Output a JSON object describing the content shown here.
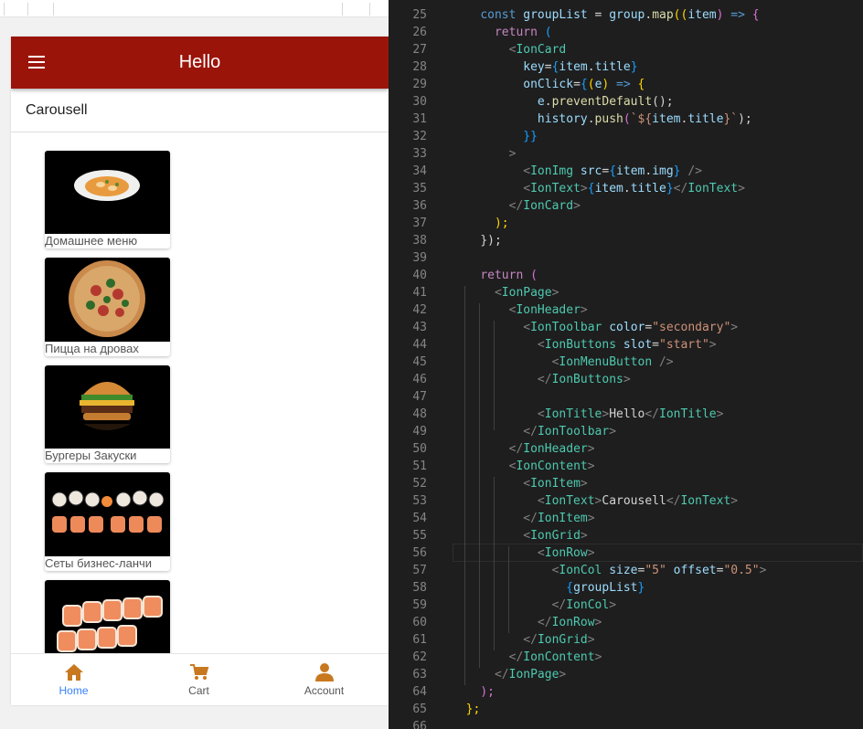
{
  "app": {
    "toolbar_title": "Hello",
    "content_item": "Carousell",
    "accent_color": "#9b1409",
    "tab_active_color": "#3880ff",
    "tab_icon_color": "#c8791f"
  },
  "cards": [
    {
      "title": "Домашнее меню",
      "image": "soup-bowl"
    },
    {
      "title": "Пицца на дровах",
      "image": "pizza"
    },
    {
      "title": "Бургеры Закуски",
      "image": "burger"
    },
    {
      "title": "Сеты бизнес-ланчи",
      "image": "sushi-set"
    },
    {
      "title": "",
      "image": "sushi-rolls"
    }
  ],
  "tabs": [
    {
      "label": "Home",
      "icon": "home-icon",
      "active": true
    },
    {
      "label": "Cart",
      "icon": "cart-icon",
      "active": false
    },
    {
      "label": "Account",
      "icon": "person-icon",
      "active": false
    }
  ],
  "editor": {
    "lines": [
      {
        "n": "25",
        "tokens": [
          [
            "    ",
            ""
          ],
          [
            "const",
            "kw"
          ],
          [
            " ",
            "txt"
          ],
          [
            "groupList",
            "var"
          ],
          [
            " = ",
            "pun"
          ],
          [
            "group",
            "var"
          ],
          [
            ".",
            "pun"
          ],
          [
            "map",
            "fn"
          ],
          [
            "((",
            "yel"
          ],
          [
            "item",
            "var"
          ],
          [
            ")",
            "pur"
          ],
          [
            " ",
            "txt"
          ],
          [
            "=>",
            "kw"
          ],
          [
            " ",
            "txt"
          ],
          [
            "{",
            "pur"
          ]
        ]
      },
      {
        "n": "26",
        "tokens": [
          [
            "      ",
            ""
          ],
          [
            "return",
            "ctl"
          ],
          [
            " ",
            "txt"
          ],
          [
            "(",
            "blu"
          ]
        ]
      },
      {
        "n": "27",
        "tokens": [
          [
            "        ",
            ""
          ],
          [
            "<",
            "br"
          ],
          [
            "IonCard",
            "tag"
          ]
        ]
      },
      {
        "n": "28",
        "tokens": [
          [
            "          ",
            ""
          ],
          [
            "key",
            "attr"
          ],
          [
            "=",
            "pun"
          ],
          [
            "{",
            "blu"
          ],
          [
            "item",
            "var"
          ],
          [
            ".",
            "pun"
          ],
          [
            "title",
            "var"
          ],
          [
            "}",
            "blu"
          ]
        ]
      },
      {
        "n": "29",
        "tokens": [
          [
            "          ",
            ""
          ],
          [
            "onClick",
            "attr"
          ],
          [
            "=",
            "pun"
          ],
          [
            "{",
            "blu"
          ],
          [
            "(",
            "yel"
          ],
          [
            "e",
            "var"
          ],
          [
            ")",
            "yel"
          ],
          [
            " ",
            "txt"
          ],
          [
            "=>",
            "kw"
          ],
          [
            " ",
            "txt"
          ],
          [
            "{",
            "yel"
          ]
        ]
      },
      {
        "n": "30",
        "tokens": [
          [
            "            ",
            ""
          ],
          [
            "e",
            "var"
          ],
          [
            ".",
            "pun"
          ],
          [
            "preventDefault",
            "fn"
          ],
          [
            "();",
            "pun"
          ]
        ]
      },
      {
        "n": "31",
        "tokens": [
          [
            "            ",
            ""
          ],
          [
            "history",
            "var"
          ],
          [
            ".",
            "pun"
          ],
          [
            "push",
            "fn"
          ],
          [
            "(",
            "pur"
          ],
          [
            "`${",
            "str"
          ],
          [
            "item",
            "var"
          ],
          [
            ".",
            "pun"
          ],
          [
            "title",
            "var"
          ],
          [
            "}`",
            "str"
          ],
          [
            ");",
            "pun"
          ]
        ]
      },
      {
        "n": "32",
        "tokens": [
          [
            "          ",
            ""
          ],
          [
            "}}",
            "blu"
          ]
        ]
      },
      {
        "n": "33",
        "tokens": [
          [
            "        ",
            ""
          ],
          [
            ">",
            "br"
          ]
        ]
      },
      {
        "n": "34",
        "tokens": [
          [
            "          ",
            ""
          ],
          [
            "<",
            "br"
          ],
          [
            "IonImg",
            "tag"
          ],
          [
            " ",
            "txt"
          ],
          [
            "src",
            "attr"
          ],
          [
            "=",
            "pun"
          ],
          [
            "{",
            "blu"
          ],
          [
            "item",
            "var"
          ],
          [
            ".",
            "pun"
          ],
          [
            "img",
            "var"
          ],
          [
            "}",
            "blu"
          ],
          [
            " ",
            "txt"
          ],
          [
            "/>",
            "br"
          ]
        ]
      },
      {
        "n": "35",
        "tokens": [
          [
            "          ",
            ""
          ],
          [
            "<",
            "br"
          ],
          [
            "IonText",
            "tag"
          ],
          [
            ">",
            "br"
          ],
          [
            "{",
            "blu"
          ],
          [
            "item",
            "var"
          ],
          [
            ".",
            "pun"
          ],
          [
            "title",
            "var"
          ],
          [
            "}",
            "blu"
          ],
          [
            "</",
            "br"
          ],
          [
            "IonText",
            "tag"
          ],
          [
            ">",
            "br"
          ]
        ]
      },
      {
        "n": "36",
        "tokens": [
          [
            "        ",
            ""
          ],
          [
            "</",
            "br"
          ],
          [
            "IonCard",
            "tag"
          ],
          [
            ">",
            "br"
          ]
        ]
      },
      {
        "n": "37",
        "tokens": [
          [
            "      ",
            ""
          ],
          [
            ");",
            "yel"
          ]
        ]
      },
      {
        "n": "38",
        "tokens": [
          [
            "    ",
            ""
          ],
          [
            "});",
            "pun"
          ]
        ]
      },
      {
        "n": "39",
        "tokens": []
      },
      {
        "n": "40",
        "tokens": [
          [
            "    ",
            ""
          ],
          [
            "return",
            "ctl"
          ],
          [
            " ",
            "txt"
          ],
          [
            "(",
            "pur"
          ]
        ]
      },
      {
        "n": "41",
        "tokens": [
          [
            "      ",
            ""
          ],
          [
            "<",
            "br"
          ],
          [
            "IonPage",
            "tag"
          ],
          [
            ">",
            "br"
          ]
        ]
      },
      {
        "n": "42",
        "tokens": [
          [
            "        ",
            ""
          ],
          [
            "<",
            "br"
          ],
          [
            "IonHeader",
            "tag"
          ],
          [
            ">",
            "br"
          ]
        ]
      },
      {
        "n": "43",
        "tokens": [
          [
            "          ",
            ""
          ],
          [
            "<",
            "br"
          ],
          [
            "IonToolbar",
            "tag"
          ],
          [
            " ",
            "txt"
          ],
          [
            "color",
            "attr"
          ],
          [
            "=",
            "pun"
          ],
          [
            "\"secondary\"",
            "str"
          ],
          [
            ">",
            "br"
          ]
        ]
      },
      {
        "n": "44",
        "tokens": [
          [
            "            ",
            ""
          ],
          [
            "<",
            "br"
          ],
          [
            "IonButtons",
            "tag"
          ],
          [
            " ",
            "txt"
          ],
          [
            "slot",
            "attr"
          ],
          [
            "=",
            "pun"
          ],
          [
            "\"start\"",
            "str"
          ],
          [
            ">",
            "br"
          ]
        ]
      },
      {
        "n": "45",
        "tokens": [
          [
            "              ",
            ""
          ],
          [
            "<",
            "br"
          ],
          [
            "IonMenuButton",
            "tag"
          ],
          [
            " ",
            "txt"
          ],
          [
            "/>",
            "br"
          ]
        ]
      },
      {
        "n": "46",
        "tokens": [
          [
            "            ",
            ""
          ],
          [
            "</",
            "br"
          ],
          [
            "IonButtons",
            "tag"
          ],
          [
            ">",
            "br"
          ]
        ]
      },
      {
        "n": "47",
        "tokens": []
      },
      {
        "n": "48",
        "tokens": [
          [
            "            ",
            ""
          ],
          [
            "<",
            "br"
          ],
          [
            "IonTitle",
            "tag"
          ],
          [
            ">",
            "br"
          ],
          [
            "Hello",
            "txt"
          ],
          [
            "</",
            "br"
          ],
          [
            "IonTitle",
            "tag"
          ],
          [
            ">",
            "br"
          ]
        ]
      },
      {
        "n": "49",
        "tokens": [
          [
            "          ",
            ""
          ],
          [
            "</",
            "br"
          ],
          [
            "IonToolbar",
            "tag"
          ],
          [
            ">",
            "br"
          ]
        ]
      },
      {
        "n": "50",
        "tokens": [
          [
            "        ",
            ""
          ],
          [
            "</",
            "br"
          ],
          [
            "IonHeader",
            "tag"
          ],
          [
            ">",
            "br"
          ]
        ]
      },
      {
        "n": "51",
        "tokens": [
          [
            "        ",
            ""
          ],
          [
            "<",
            "br"
          ],
          [
            "IonContent",
            "tag"
          ],
          [
            ">",
            "br"
          ]
        ]
      },
      {
        "n": "52",
        "tokens": [
          [
            "          ",
            ""
          ],
          [
            "<",
            "br"
          ],
          [
            "IonItem",
            "tag"
          ],
          [
            ">",
            "br"
          ]
        ]
      },
      {
        "n": "53",
        "tokens": [
          [
            "            ",
            ""
          ],
          [
            "<",
            "br"
          ],
          [
            "IonText",
            "tag"
          ],
          [
            ">",
            "br"
          ],
          [
            "Carousell",
            "txt"
          ],
          [
            "</",
            "br"
          ],
          [
            "IonText",
            "tag"
          ],
          [
            ">",
            "br"
          ]
        ]
      },
      {
        "n": "54",
        "tokens": [
          [
            "          ",
            ""
          ],
          [
            "</",
            "br"
          ],
          [
            "IonItem",
            "tag"
          ],
          [
            ">",
            "br"
          ]
        ]
      },
      {
        "n": "55",
        "tokens": [
          [
            "          ",
            ""
          ],
          [
            "<",
            "br"
          ],
          [
            "IonGrid",
            "tag"
          ],
          [
            ">",
            "br"
          ]
        ]
      },
      {
        "n": "56",
        "tokens": [
          [
            "            ",
            ""
          ],
          [
            "<",
            "br"
          ],
          [
            "IonRow",
            "tag"
          ],
          [
            ">",
            "br"
          ]
        ]
      },
      {
        "n": "57",
        "tokens": [
          [
            "              ",
            ""
          ],
          [
            "<",
            "br"
          ],
          [
            "IonCol",
            "tag"
          ],
          [
            " ",
            "txt"
          ],
          [
            "size",
            "attr"
          ],
          [
            "=",
            "pun"
          ],
          [
            "\"5\"",
            "str"
          ],
          [
            " ",
            "txt"
          ],
          [
            "offset",
            "attr"
          ],
          [
            "=",
            "pun"
          ],
          [
            "\"0.5\"",
            "str"
          ],
          [
            ">",
            "br"
          ]
        ]
      },
      {
        "n": "58",
        "tokens": [
          [
            "                ",
            ""
          ],
          [
            "{",
            "blu"
          ],
          [
            "groupList",
            "var"
          ],
          [
            "}",
            "blu"
          ]
        ]
      },
      {
        "n": "59",
        "tokens": [
          [
            "              ",
            ""
          ],
          [
            "</",
            "br"
          ],
          [
            "IonCol",
            "tag"
          ],
          [
            ">",
            "br"
          ]
        ]
      },
      {
        "n": "60",
        "tokens": [
          [
            "            ",
            ""
          ],
          [
            "</",
            "br"
          ],
          [
            "IonRow",
            "tag"
          ],
          [
            ">",
            "br"
          ]
        ]
      },
      {
        "n": "61",
        "tokens": [
          [
            "          ",
            ""
          ],
          [
            "</",
            "br"
          ],
          [
            "IonGrid",
            "tag"
          ],
          [
            ">",
            "br"
          ]
        ]
      },
      {
        "n": "62",
        "tokens": [
          [
            "        ",
            ""
          ],
          [
            "</",
            "br"
          ],
          [
            "IonContent",
            "tag"
          ],
          [
            ">",
            "br"
          ]
        ]
      },
      {
        "n": "63",
        "tokens": [
          [
            "      ",
            ""
          ],
          [
            "</",
            "br"
          ],
          [
            "IonPage",
            "tag"
          ],
          [
            ">",
            "br"
          ]
        ]
      },
      {
        "n": "64",
        "tokens": [
          [
            "    ",
            ""
          ],
          [
            ");",
            "pur"
          ]
        ]
      },
      {
        "n": "65",
        "tokens": [
          [
            "  ",
            ""
          ],
          [
            "};",
            "yel"
          ]
        ]
      },
      {
        "n": "66",
        "tokens": []
      }
    ]
  }
}
